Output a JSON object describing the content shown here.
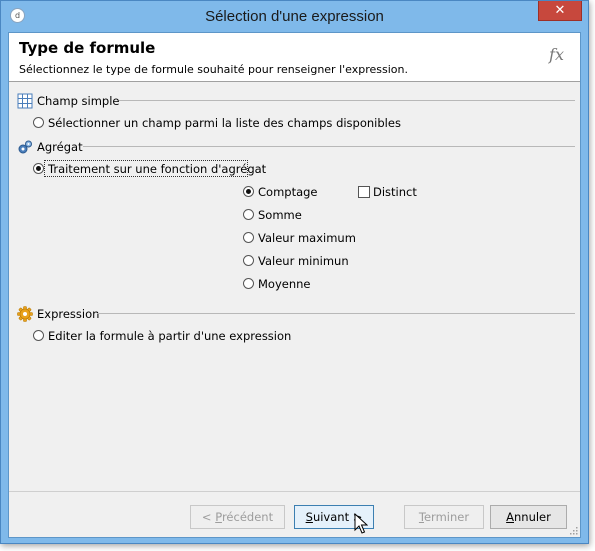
{
  "window": {
    "title": "Sélection d'une expression",
    "app_icon_glyph": "d",
    "close_glyph": "✕"
  },
  "header": {
    "title": "Type de formule",
    "subtitle": "Sélectionnez le type de formule souhaité pour renseigner l'expression.",
    "fx_label": "fx"
  },
  "sections": {
    "simple": {
      "label": "Champ simple",
      "icon": "grid-icon",
      "option_label": "Sélectionner un champ parmi la liste des champs disponibles",
      "option_checked": false
    },
    "aggregate": {
      "label": "Agrégat",
      "icon": "gears-icon",
      "option_label": "Traitement sur une fonction d'agrégat",
      "option_checked": true,
      "functions": [
        {
          "label": "Comptage",
          "checked": true
        },
        {
          "label": "Somme",
          "checked": false
        },
        {
          "label": "Valeur maximum",
          "checked": false
        },
        {
          "label": "Valeur minimun",
          "checked": false
        },
        {
          "label": "Moyenne",
          "checked": false
        }
      ],
      "distinct_label": "Distinct",
      "distinct_checked": false
    },
    "expression": {
      "label": "Expression",
      "icon": "gear-icon",
      "option_label": "Editer la formule à partir d'une expression",
      "option_checked": false
    }
  },
  "buttons": {
    "previous": {
      "prefix": "< ",
      "mnemonic": "P",
      "rest": "récédent",
      "enabled": false
    },
    "next": {
      "mnemonic": "S",
      "rest": "uivant >",
      "enabled": true
    },
    "finish": {
      "mnemonic": "T",
      "rest": "erminer",
      "enabled": false
    },
    "cancel": {
      "mnemonic": "A",
      "rest": "nnuler",
      "enabled": true
    }
  },
  "colors": {
    "title_bar": "#7fb9ea",
    "close_button": "#c7483d",
    "accent_gear": "#e9a21b",
    "grid_icon": "#4a7ebb"
  }
}
